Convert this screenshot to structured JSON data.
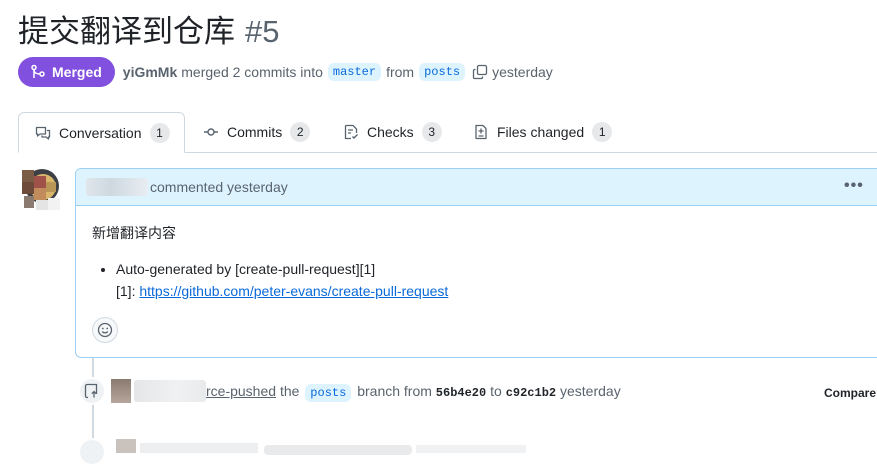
{
  "pr": {
    "title": "提交翻译到仓库",
    "number": "#5",
    "state_label": "Merged",
    "author": "yiGmMk",
    "merged_text": "merged 2 commits into",
    "base_branch": "master",
    "from_text": "from",
    "head_branch": "posts",
    "time": "yesterday"
  },
  "tabs": [
    {
      "label": "Conversation",
      "count": "1",
      "icon": "comment-discussion-icon"
    },
    {
      "label": "Commits",
      "count": "2",
      "icon": "git-commit-icon"
    },
    {
      "label": "Checks",
      "count": "3",
      "icon": "checklist-icon"
    },
    {
      "label": "Files changed",
      "count": "1",
      "icon": "file-diff-icon"
    }
  ],
  "comment": {
    "header_text": "commented yesterday",
    "heading": "新增翻译内容",
    "bullet_line1": "Auto-generated by [create-pull-request][1]",
    "bullet_line2_prefix": "[1]:",
    "link": "https://github.com/peter-evans/create-pull-request",
    "menu_icon": "kebab-horizontal-icon",
    "reaction_icon": "smiley-icon"
  },
  "event": {
    "actor_tail": "rce-pushed",
    "text1": "the",
    "branch": "posts",
    "text2": "branch from",
    "from_sha": "56b4e20",
    "to_text": "to",
    "to_sha": "c92c1b2",
    "time": "yesterday",
    "compare_label": "Compare",
    "icon": "repo-push-icon"
  },
  "colors": {
    "merged": "#8250df",
    "link": "#0969da",
    "comment_header_bg": "#ddf4ff",
    "comment_border": "#9cd0f3"
  }
}
